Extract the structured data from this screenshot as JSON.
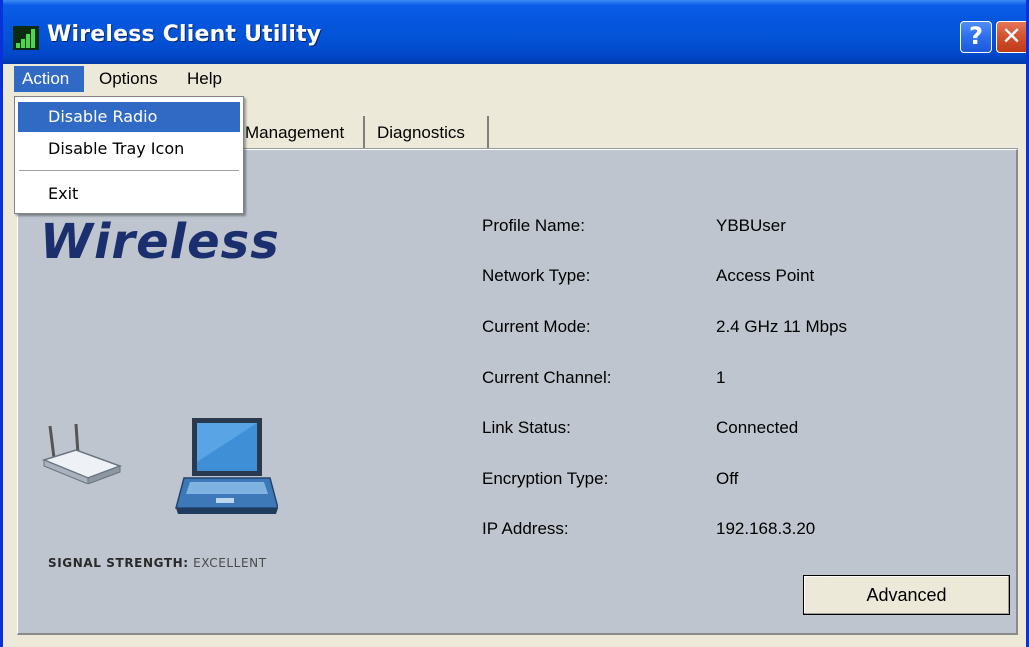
{
  "window": {
    "title": "Wireless Client Utility",
    "app_icon": "wireless-signal-icon",
    "controls": {
      "help_label": "?",
      "close_label": "✕"
    }
  },
  "menubar": {
    "items": [
      {
        "label": "Action",
        "active": true
      },
      {
        "label": "Options"
      },
      {
        "label": "Help"
      }
    ]
  },
  "action_menu": {
    "items": [
      {
        "label": "Disable Radio",
        "highlighted": true
      },
      {
        "label": "Disable Tray Icon"
      },
      {
        "separator": true
      },
      {
        "label": "Exit"
      }
    ]
  },
  "tabs": [
    {
      "label": "Management"
    },
    {
      "label": "Diagnostics"
    }
  ],
  "panel": {
    "brand": "Wireless",
    "signal_strength_label": "SIGNAL STRENGTH:",
    "signal_strength_value": "EXCELLENT",
    "icons": [
      "router-icon",
      "laptop-icon"
    ],
    "info": [
      {
        "label": "Profile Name:",
        "value": "YBBUser"
      },
      {
        "label": "Network Type:",
        "value": "Access Point"
      },
      {
        "label": "Current Mode:",
        "value": "2.4 GHz 11 Mbps"
      },
      {
        "label": "Current Channel:",
        "value": "1"
      },
      {
        "label": "Link Status:",
        "value": "Connected"
      },
      {
        "label": "Encryption Type:",
        "value": "Off"
      },
      {
        "label": "IP Address:",
        "value": "192.168.3.20"
      }
    ],
    "advanced_button": "Advanced"
  },
  "colors": {
    "titlebar": "#0453d6",
    "menu_highlight": "#316ac5",
    "panel_bg": "#bec5ce",
    "window_bg": "#ece9d8",
    "brand_text": "#1b2f6e"
  }
}
